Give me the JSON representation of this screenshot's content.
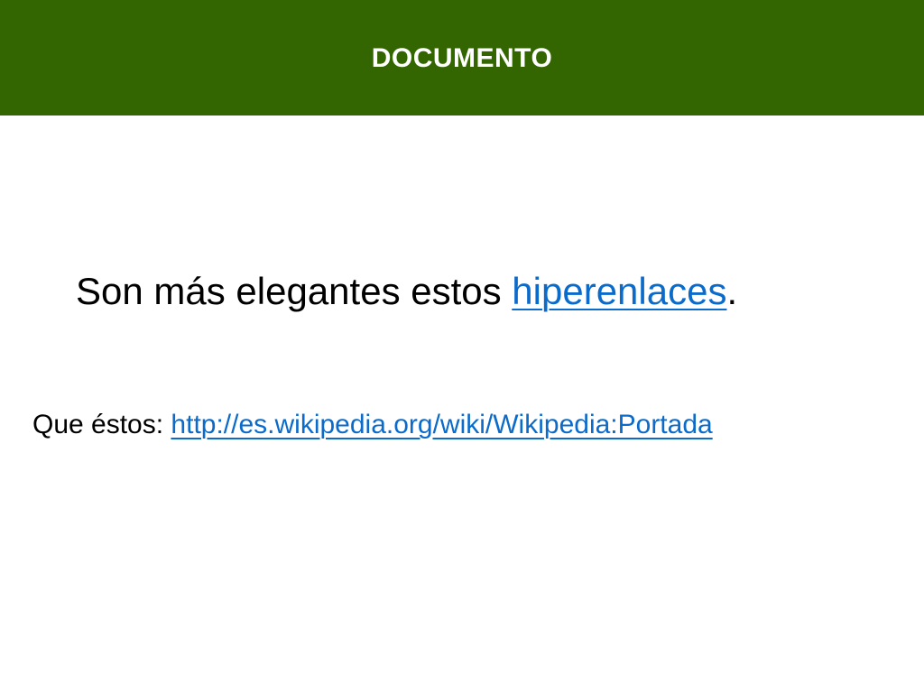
{
  "header": {
    "title": "DOCUMENTO",
    "background_color": "#336600",
    "text_color": "#ffffff"
  },
  "body": {
    "line1": {
      "prefix": "Son más elegantes estos ",
      "link_text": "hiperenlaces",
      "suffix": "."
    },
    "line2": {
      "prefix": "Que éstos: ",
      "link_text": "http://es.wikipedia.org/wiki/Wikipedia:Portada"
    },
    "link_color": "#0b6bcb"
  }
}
